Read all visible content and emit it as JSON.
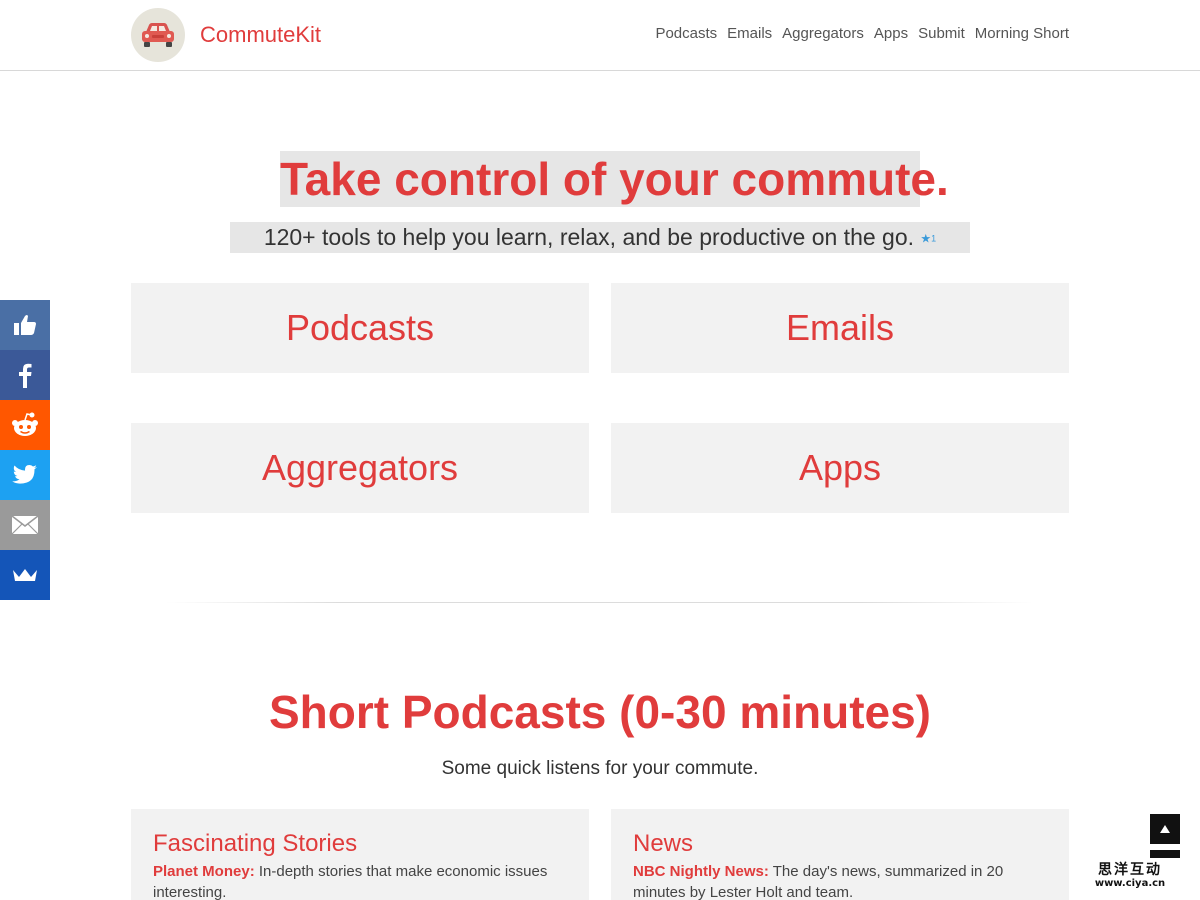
{
  "header": {
    "brand": "CommuteKit",
    "nav": [
      "Podcasts",
      "Emails",
      "Aggregators",
      "Apps",
      "Submit",
      "Morning Short"
    ]
  },
  "hero": {
    "title": "Take control of your commute.",
    "subtitle": "120+ tools to help you learn, relax, and be productive on the go.",
    "star_count": "1"
  },
  "categories": [
    "Podcasts",
    "Emails",
    "Aggregators",
    "Apps"
  ],
  "section": {
    "title": "Short Podcasts (0-30 minutes)",
    "subtitle": "Some quick listens for your commute."
  },
  "cards": [
    {
      "title": "Fascinating Stories",
      "podcast": "Planet Money",
      "description": "In-depth stories that make economic issues interesting."
    },
    {
      "title": "News",
      "podcast": "NBC Nightly News",
      "description": "The day's news, summarized in 20 minutes by Lester Holt and team."
    }
  ],
  "social": {
    "items": [
      {
        "icon": "thumbs-up-icon",
        "color": "#4a6fa5"
      },
      {
        "icon": "facebook-icon",
        "color": "#3b5998"
      },
      {
        "icon": "reddit-icon",
        "color": "#ff5700"
      },
      {
        "icon": "twitter-icon",
        "color": "#1da1f2"
      },
      {
        "icon": "email-icon",
        "color": "#9a9a9a"
      },
      {
        "icon": "sumo-crown-icon",
        "color": "#1455b8"
      }
    ]
  },
  "watermark": {
    "cn": "思洋互动",
    "url": "www.ciya.cn"
  },
  "colors": {
    "accent": "#e03c3c",
    "tile_bg": "#f2f2f2",
    "highlight_bg": "#e6e6e6"
  }
}
